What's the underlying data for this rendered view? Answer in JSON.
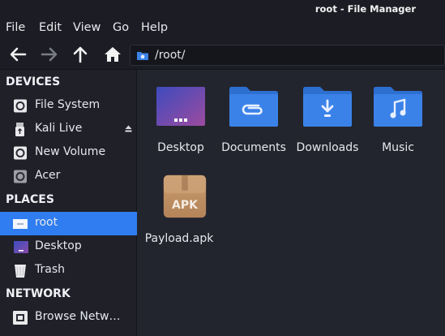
{
  "window": {
    "title": "root - File Manager"
  },
  "menu": [
    "File",
    "Edit",
    "View",
    "Go",
    "Help"
  ],
  "toolbar": {
    "path": "/root/"
  },
  "sidebar": {
    "devices_header": "DEVICES",
    "devices": [
      {
        "label": "File System",
        "icon": "drive-icon"
      },
      {
        "label": "Kali Live",
        "icon": "usb-drive-icon"
      },
      {
        "label": "New Volume",
        "icon": "drive-icon"
      },
      {
        "label": "Acer",
        "icon": "drive-icon"
      }
    ],
    "places_header": "PLACES",
    "places": [
      {
        "label": "root",
        "icon": "home-folder-icon",
        "selected": true
      },
      {
        "label": "Desktop",
        "icon": "desktop-icon"
      },
      {
        "label": "Trash",
        "icon": "trash-icon"
      }
    ],
    "network_header": "NETWORK",
    "network": [
      {
        "label": "Browse Netw…",
        "icon": "network-icon"
      }
    ]
  },
  "files": [
    {
      "name": "Desktop",
      "icon": "desktop-folder-icon"
    },
    {
      "name": "Documents",
      "icon": "documents-folder-icon"
    },
    {
      "name": "Downloads",
      "icon": "downloads-folder-icon"
    },
    {
      "name": "Music",
      "icon": "music-folder-icon"
    },
    {
      "name": "Payload.apk",
      "icon": "apk-package-icon",
      "badge": "APK"
    }
  ],
  "colors": {
    "accent": "#2f7df0",
    "folder": "#3b82e8",
    "background": "#23252e",
    "sidebar": "#1f2028"
  }
}
